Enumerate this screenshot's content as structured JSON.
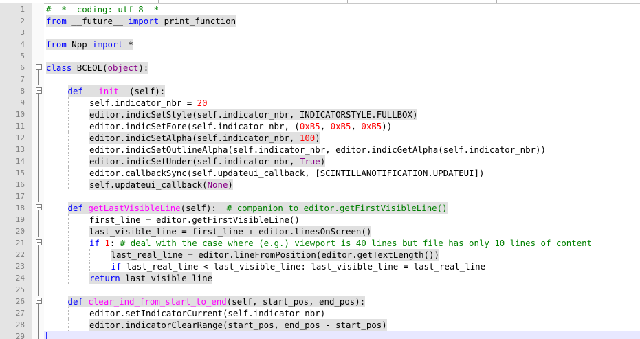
{
  "colors": {
    "keyword": "#0000ff",
    "builtin": "#880088",
    "number": "#ff0000",
    "comment": "#008000",
    "classname": "#000000",
    "defname": "#ff00ff",
    "plain": "#000000",
    "highlight_bg": "#e0e0e0",
    "gutter_bg": "#e4e4e4"
  },
  "lines": [
    {
      "n": "1",
      "indent": 0,
      "fold": "",
      "hl": false,
      "tokens": [
        {
          "t": "# -*- coding: utf-8 -*-",
          "c": "comment"
        }
      ]
    },
    {
      "n": "2",
      "indent": 0,
      "fold": "",
      "hl": true,
      "tokens": [
        {
          "t": "from",
          "c": "keyword"
        },
        {
          "t": " __future__ ",
          "c": "plain"
        },
        {
          "t": "import",
          "c": "keyword"
        },
        {
          "t": " print_function",
          "c": "plain"
        }
      ]
    },
    {
      "n": "3",
      "indent": 0,
      "fold": "",
      "hl": false,
      "tokens": []
    },
    {
      "n": "4",
      "indent": 0,
      "fold": "",
      "hl": true,
      "tokens": [
        {
          "t": "from",
          "c": "keyword"
        },
        {
          "t": " Npp ",
          "c": "plain"
        },
        {
          "t": "import",
          "c": "keyword"
        },
        {
          "t": " *",
          "c": "plain"
        }
      ]
    },
    {
      "n": "5",
      "indent": 0,
      "fold": "",
      "hl": false,
      "tokens": []
    },
    {
      "n": "6",
      "indent": 0,
      "fold": "box",
      "hl": true,
      "tokens": [
        {
          "t": "class",
          "c": "keyword"
        },
        {
          "t": " BCEOL",
          "c": "classname"
        },
        {
          "t": "(",
          "c": "plain"
        },
        {
          "t": "object",
          "c": "builtin"
        },
        {
          "t": "):",
          "c": "plain"
        }
      ]
    },
    {
      "n": "7",
      "indent": 0,
      "fold": "line",
      "hl": false,
      "tokens": []
    },
    {
      "n": "8",
      "indent": 1,
      "fold": "box",
      "hl": true,
      "tokens": [
        {
          "t": "def",
          "c": "keyword"
        },
        {
          "t": " __init__",
          "c": "defname"
        },
        {
          "t": "(self):",
          "c": "plain"
        }
      ]
    },
    {
      "n": "9",
      "indent": 2,
      "fold": "line",
      "hl": false,
      "tokens": [
        {
          "t": "self.indicator_nbr = ",
          "c": "plain"
        },
        {
          "t": "20",
          "c": "number"
        }
      ]
    },
    {
      "n": "10",
      "indent": 2,
      "fold": "line",
      "hl": true,
      "tokens": [
        {
          "t": "editor.indicSetStyle(self.indicator_nbr, INDICATORSTYLE.FULLBOX)",
          "c": "plain"
        }
      ]
    },
    {
      "n": "11",
      "indent": 2,
      "fold": "line",
      "hl": false,
      "tokens": [
        {
          "t": "editor.indicSetFore(self.indicator_nbr, (",
          "c": "plain"
        },
        {
          "t": "0xB5",
          "c": "number"
        },
        {
          "t": ", ",
          "c": "plain"
        },
        {
          "t": "0xB5",
          "c": "number"
        },
        {
          "t": ", ",
          "c": "plain"
        },
        {
          "t": "0xB5",
          "c": "number"
        },
        {
          "t": "))",
          "c": "plain"
        }
      ]
    },
    {
      "n": "12",
      "indent": 2,
      "fold": "line",
      "hl": true,
      "tokens": [
        {
          "t": "editor.indicSetAlpha(self.indicator_nbr, ",
          "c": "plain"
        },
        {
          "t": "100",
          "c": "number"
        },
        {
          "t": ")",
          "c": "plain"
        }
      ]
    },
    {
      "n": "13",
      "indent": 2,
      "fold": "line",
      "hl": false,
      "tokens": [
        {
          "t": "editor.indicSetOutlineAlpha(self.indicator_nbr, editor.indicGetAlpha(self.indicator_nbr))",
          "c": "plain"
        }
      ]
    },
    {
      "n": "14",
      "indent": 2,
      "fold": "line",
      "hl": true,
      "tokens": [
        {
          "t": "editor.indicSetUnder(self.indicator_nbr, ",
          "c": "plain"
        },
        {
          "t": "True",
          "c": "builtin"
        },
        {
          "t": ")",
          "c": "plain"
        }
      ]
    },
    {
      "n": "15",
      "indent": 2,
      "fold": "line",
      "hl": false,
      "tokens": [
        {
          "t": "editor.callbackSync(self.updateui_callback, [SCINTILLANOTIFICATION.UPDATEUI])",
          "c": "plain"
        }
      ]
    },
    {
      "n": "16",
      "indent": 2,
      "fold": "line",
      "hl": true,
      "tokens": [
        {
          "t": "self.updateui_callback(",
          "c": "plain"
        },
        {
          "t": "None",
          "c": "builtin"
        },
        {
          "t": ")",
          "c": "plain"
        }
      ]
    },
    {
      "n": "17",
      "indent": 0,
      "fold": "line",
      "hl": false,
      "tokens": []
    },
    {
      "n": "18",
      "indent": 1,
      "fold": "box",
      "hl": true,
      "tokens": [
        {
          "t": "def",
          "c": "keyword"
        },
        {
          "t": " getLastVisibleLine",
          "c": "defname"
        },
        {
          "t": "(self):  ",
          "c": "plain"
        },
        {
          "t": "# companion to editor.getFirstVisibleLine()",
          "c": "comment"
        }
      ]
    },
    {
      "n": "19",
      "indent": 2,
      "fold": "line",
      "hl": false,
      "tokens": [
        {
          "t": "first_line = editor.getFirstVisibleLine()",
          "c": "plain"
        }
      ]
    },
    {
      "n": "20",
      "indent": 2,
      "fold": "line",
      "hl": true,
      "tokens": [
        {
          "t": "last_visible_line = first_line + editor.linesOnScreen()",
          "c": "plain"
        }
      ]
    },
    {
      "n": "21",
      "indent": 2,
      "fold": "box",
      "hl": false,
      "tokens": [
        {
          "t": "if",
          "c": "keyword"
        },
        {
          "t": " ",
          "c": "plain"
        },
        {
          "t": "1",
          "c": "number"
        },
        {
          "t": ": ",
          "c": "plain"
        },
        {
          "t": "# deal with the case where (e.g.) viewport is 40 lines but file has only 10 lines of content",
          "c": "comment"
        }
      ]
    },
    {
      "n": "22",
      "indent": 3,
      "fold": "line",
      "hl": true,
      "tokens": [
        {
          "t": "last_real_line = editor.lineFromPosition(editor.getTextLength())",
          "c": "plain"
        }
      ]
    },
    {
      "n": "23",
      "indent": 3,
      "fold": "line",
      "hl": false,
      "tokens": [
        {
          "t": "if",
          "c": "keyword"
        },
        {
          "t": " last_real_line < last_visible_line: last_visible_line = last_real_line",
          "c": "plain"
        }
      ]
    },
    {
      "n": "24",
      "indent": 2,
      "fold": "line",
      "hl": true,
      "tokens": [
        {
          "t": "return",
          "c": "keyword"
        },
        {
          "t": " last_visible_line",
          "c": "plain"
        }
      ]
    },
    {
      "n": "25",
      "indent": 0,
      "fold": "line",
      "hl": false,
      "tokens": []
    },
    {
      "n": "26",
      "indent": 1,
      "fold": "box",
      "hl": true,
      "tokens": [
        {
          "t": "def",
          "c": "keyword"
        },
        {
          "t": " clear_ind_from_start_to_end",
          "c": "defname"
        },
        {
          "t": "(self, start_pos, end_pos):",
          "c": "plain"
        }
      ]
    },
    {
      "n": "27",
      "indent": 2,
      "fold": "line",
      "hl": false,
      "tokens": [
        {
          "t": "editor.setIndicatorCurrent(self.indicator_nbr)",
          "c": "plain"
        }
      ]
    },
    {
      "n": "28",
      "indent": 2,
      "fold": "line",
      "hl": true,
      "tokens": [
        {
          "t": "editor.indicatorClearRange(start_pos, end_pos - start_pos)",
          "c": "plain"
        }
      ]
    },
    {
      "n": "29",
      "indent": 0,
      "fold": "line",
      "hl": false,
      "tokens": [],
      "caret": true
    }
  ]
}
